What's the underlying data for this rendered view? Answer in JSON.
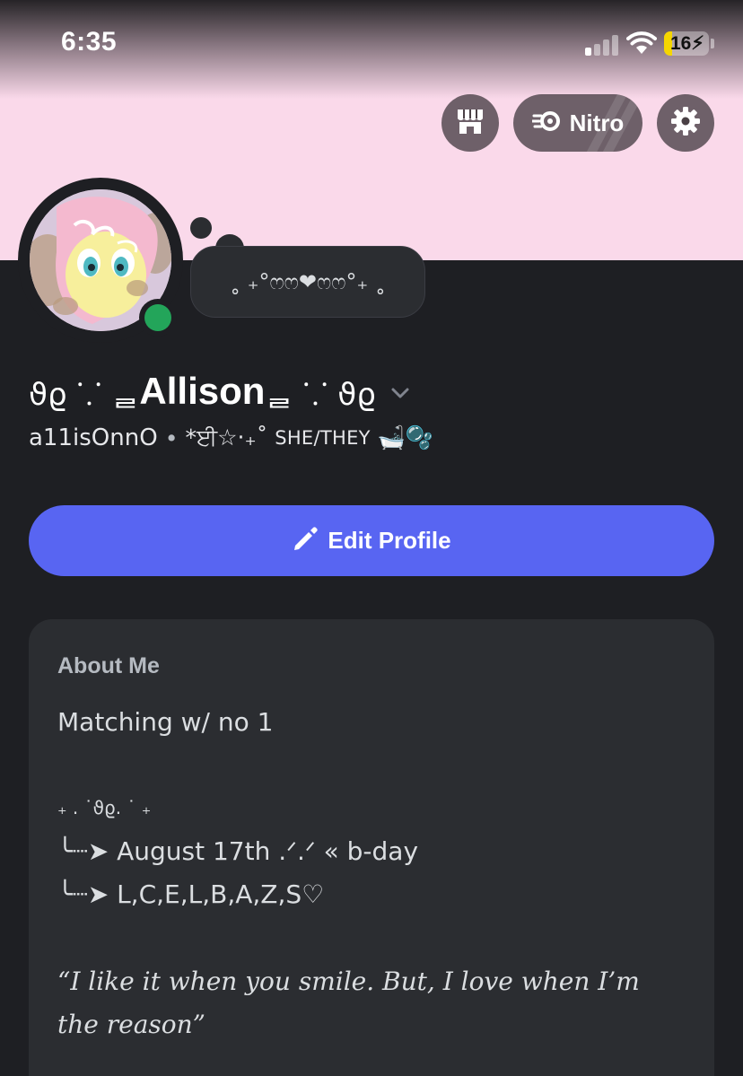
{
  "status_bar": {
    "time": "6:35",
    "battery": "16",
    "icons": [
      "cellular-signal-icon",
      "wifi-icon",
      "battery-charging-icon"
    ]
  },
  "banner": {
    "color": "#fad9ea"
  },
  "header_buttons": {
    "shop_icon": "shop-icon",
    "nitro_label": "Nitro",
    "settings_icon": "gear-icon"
  },
  "profile": {
    "status_bubble": "˳ ₊°ෆෆ❤ෆෆ°₊ ˳",
    "display_name_prefix": "ϑϱ ⸪ ᆯ ",
    "display_name": "Allison",
    "display_name_suffix": " ᆯ ⸪ ϑϱ",
    "username": "a11isOnnO",
    "separator": "•",
    "pronouns_deco": "*ਈ☆‧₊˚",
    "pronouns": "SHE/THEY",
    "pronouns_emoji": "🛁🫧",
    "online_status_color": "#23a55a"
  },
  "actions": {
    "edit_profile_label": "Edit Profile"
  },
  "about": {
    "title": "About Me",
    "line1": "Matching w/ no 1",
    "deco": "₊ . ˙ϑϱ. ˙ ₊",
    "line2": "╰┈➤ August 17th .ᐟ.ᐟ « b-day",
    "line3": "╰┈➤ L,C,E,L,B,A,Z,S♡",
    "quote": "“I like it when you smile. But, I love when I’m the reason”"
  },
  "colors": {
    "accent": "#5865f2",
    "background": "#1e1f23",
    "card": "#2b2d31"
  }
}
